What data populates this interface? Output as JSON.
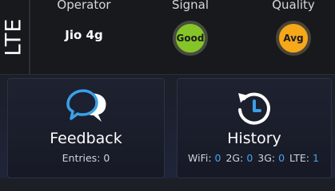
{
  "network": {
    "type": "LTE"
  },
  "status": {
    "operator_label": "Operator",
    "operator_value": "Jio 4g",
    "signal_label": "Signal",
    "signal_value": "Good",
    "quality_label": "Quality",
    "quality_value": "Avg"
  },
  "colors": {
    "signal_good": "#86c528",
    "quality_avg": "#f4a81a",
    "accent_blue": "#45a6ea"
  },
  "cards": {
    "feedback": {
      "icon": "chat-bubbles-icon",
      "title": "Feedback",
      "entries_label": "Entries:",
      "entries_value": "0"
    },
    "history": {
      "icon": "history-clock-icon",
      "title": "History",
      "stats": [
        {
          "label": "WiFi:",
          "value": "0"
        },
        {
          "label": "2G:",
          "value": "0"
        },
        {
          "label": "3G:",
          "value": "0"
        },
        {
          "label": "LTE:",
          "value": "1"
        }
      ]
    }
  }
}
